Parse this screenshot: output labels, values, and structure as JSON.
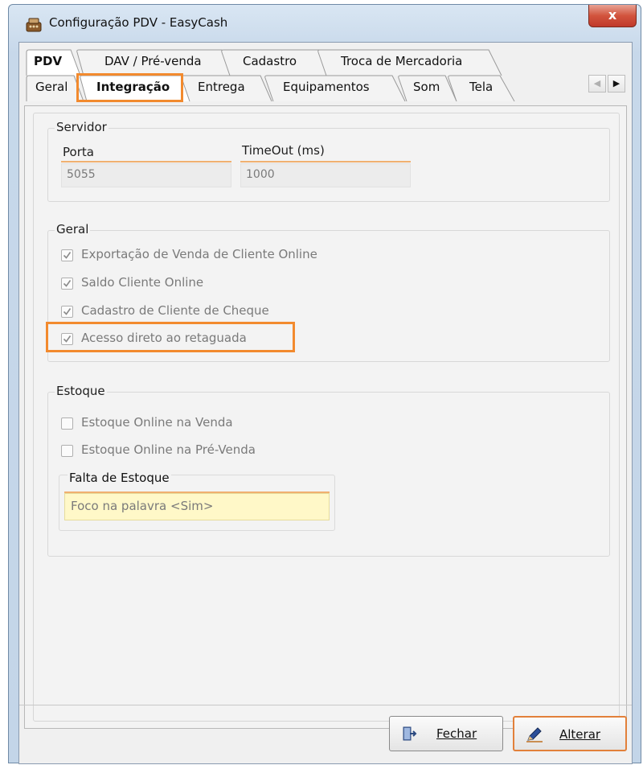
{
  "window": {
    "title": "Configuração PDV - EasyCash",
    "close_label": "x"
  },
  "tabs_row1": [
    {
      "label": "PDV",
      "active": true
    },
    {
      "label": "DAV / Pré-venda",
      "active": false
    },
    {
      "label": "Cadastro",
      "active": false
    },
    {
      "label": "Troca de Mercadoria",
      "active": false
    }
  ],
  "tabs_row2": [
    {
      "label": "Geral",
      "active": false
    },
    {
      "label": "Integração",
      "active": true
    },
    {
      "label": "Entrega",
      "active": false
    },
    {
      "label": "Equipamentos",
      "active": false
    },
    {
      "label": "Som",
      "active": false
    },
    {
      "label": "Tela",
      "active": false
    }
  ],
  "tab_scroll": {
    "left": "◀",
    "right": "▶"
  },
  "servidor": {
    "title": "Servidor",
    "porta_label": "Porta",
    "porta_value": "5055",
    "timeout_label": "TimeOut (ms)",
    "timeout_value": "1000"
  },
  "geral": {
    "title": "Geral",
    "items": [
      {
        "label": "Exportação de Venda de Cliente Online",
        "checked": true
      },
      {
        "label": "Saldo Cliente Online",
        "checked": true
      },
      {
        "label": "Cadastro de Cliente de Cheque",
        "checked": true
      },
      {
        "label": "Acesso direto ao retaguada",
        "checked": true
      }
    ]
  },
  "estoque": {
    "title": "Estoque",
    "items": [
      {
        "label": "Estoque Online na Venda",
        "checked": false
      },
      {
        "label": "Estoque Online na Pré-Venda",
        "checked": false
      }
    ],
    "falta_title": "Falta de Estoque",
    "falta_value": "Foco na palavra <Sim>"
  },
  "buttons": {
    "fechar": "Fechar",
    "alterar": "Alterar"
  },
  "colors": {
    "highlight": "#f28a2e",
    "field_underline": "#f0b070",
    "yellow_field": "#fff8c8"
  }
}
